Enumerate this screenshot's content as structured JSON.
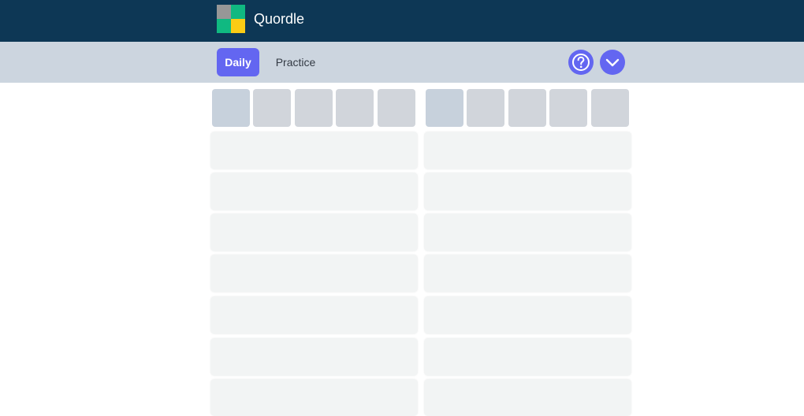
{
  "header": {
    "app_title": "Quordle",
    "logo_colors": [
      "#979797",
      "#10b981",
      "#10b981",
      "#facc15"
    ]
  },
  "toolbar": {
    "tabs": [
      {
        "label": "Daily",
        "active": true
      },
      {
        "label": "Practice",
        "active": false
      }
    ],
    "help_icon": "question-circle-icon",
    "dropdown_icon": "chevron-down-icon",
    "accent_color": "#6366f1"
  },
  "boards": [
    {
      "input_tiles": [
        "",
        "",
        "",
        "",
        ""
      ],
      "guess_rows": 7
    },
    {
      "input_tiles": [
        "",
        "",
        "",
        "",
        ""
      ],
      "guess_rows": 7
    }
  ],
  "colors": {
    "header_bg": "#0d3755",
    "toolbar_bg": "#ccd5df",
    "tile_bg": "#d1d5db",
    "row_bg": "#f2f4f4"
  }
}
